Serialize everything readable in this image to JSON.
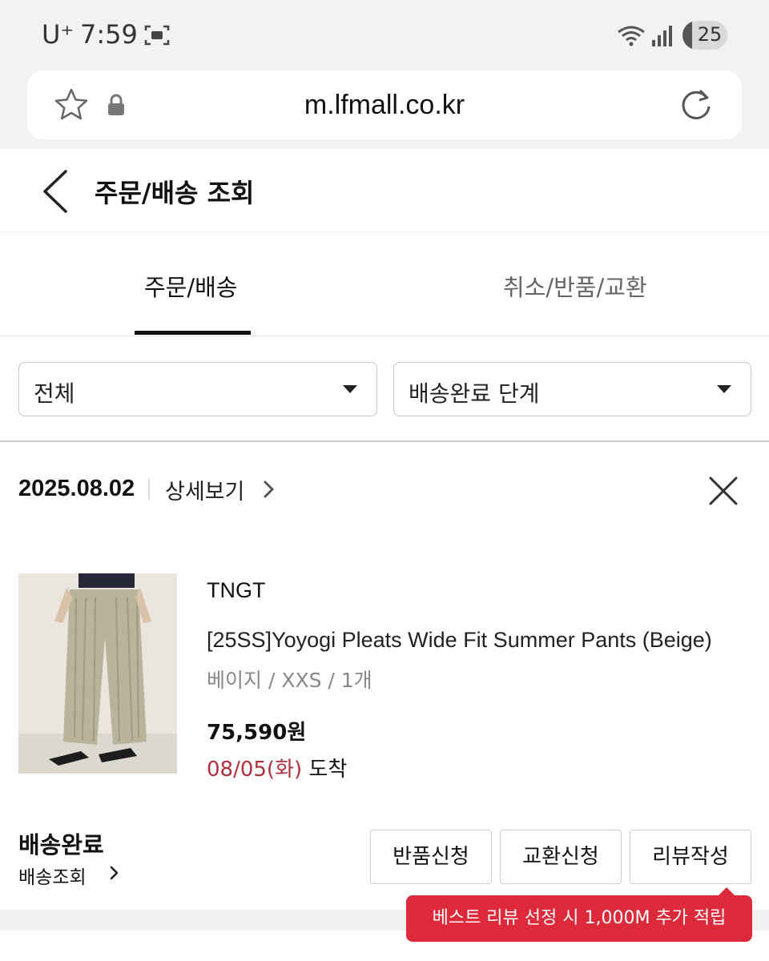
{
  "status_bar": {
    "carrier": "U⁺",
    "time": "7:59",
    "battery": "25"
  },
  "browser": {
    "url": "m.lfmall.co.kr"
  },
  "header": {
    "title": "주문/배송 조회"
  },
  "tabs": [
    {
      "label": "주문/배송",
      "active": true
    },
    {
      "label": "취소/반품/교환",
      "active": false
    }
  ],
  "filters": {
    "period": "전체",
    "stage": "배송완료 단계"
  },
  "order": {
    "date": "2025.08.02",
    "detail_label": "상세보기",
    "product": {
      "brand": "TNGT",
      "name": "[25SS]Yoyogi Pleats Wide Fit Summer Pants (Beige)",
      "option": "베이지 / XXS / 1개",
      "price": "75,590원",
      "arrival_date": "08/05(화)",
      "arrival_word": "도착"
    },
    "status": "배송완료",
    "track_label": "배송조회",
    "actions": {
      "return": "반품신청",
      "exchange": "교환신청",
      "review": "리뷰작성"
    },
    "tooltip": "베스트 리뷰 선정 시 1,000M 추가 적립"
  },
  "colors": {
    "accent_red": "#dd2a3a",
    "arrival_red": "#b0303c"
  }
}
